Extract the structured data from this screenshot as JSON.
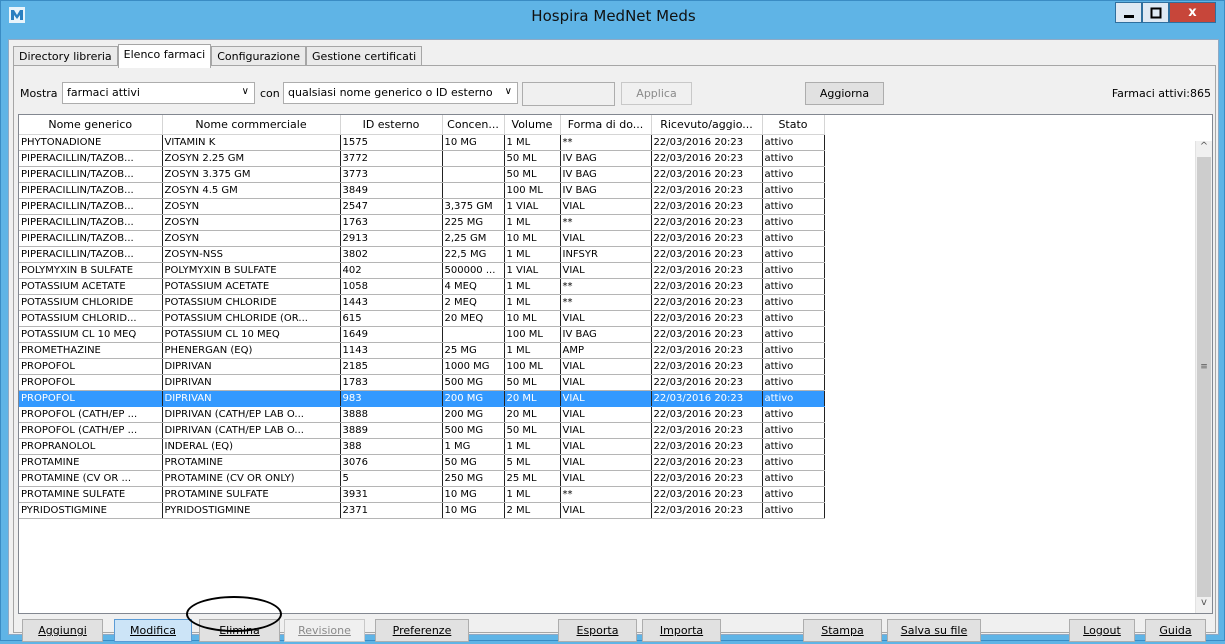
{
  "window": {
    "title": "Hospira MedNet Meds",
    "minimize_glyph": "‒",
    "maximize_glyph": "□",
    "close_glyph": "x"
  },
  "tabs": [
    "Directory libreria",
    "Elenco farmaci",
    "Configurazione",
    "Gestione certificati"
  ],
  "filter": {
    "show_label": "Mostra",
    "show_value": "farmaci attivi",
    "with_label": "con",
    "with_value": "qualsiasi nome generico o ID esterno",
    "apply_label": "Applica",
    "refresh_label": "Aggiorna",
    "count_text": "Farmaci attivi:865"
  },
  "table": {
    "columns": [
      "Nome generico",
      "Nome cormmerciale",
      "ID esterno",
      "Concen...",
      "Volume",
      "Forma di do...",
      "Ricevuto/aggio...",
      "Stato"
    ],
    "selected_row_index": 16,
    "rows": [
      [
        "PHYTONADIONE",
        "VITAMIN K",
        "1575",
        "10 MG",
        "1 ML",
        "**",
        "22/03/2016 20:23",
        "attivo"
      ],
      [
        "PIPERACILLIN/TAZOB...",
        "ZOSYN 2.25 GM",
        "3772",
        "",
        "50 ML",
        "IV BAG",
        "22/03/2016 20:23",
        "attivo"
      ],
      [
        "PIPERACILLIN/TAZOB...",
        "ZOSYN 3.375 GM",
        "3773",
        "",
        "50 ML",
        "IV BAG",
        "22/03/2016 20:23",
        "attivo"
      ],
      [
        "PIPERACILLIN/TAZOB...",
        "ZOSYN 4.5 GM",
        "3849",
        "",
        "100 ML",
        "IV BAG",
        "22/03/2016 20:23",
        "attivo"
      ],
      [
        "PIPERACILLIN/TAZOB...",
        "ZOSYN",
        "2547",
        "3,375 GM",
        "1 VIAL",
        "VIAL",
        "22/03/2016 20:23",
        "attivo"
      ],
      [
        "PIPERACILLIN/TAZOB...",
        "ZOSYN",
        "1763",
        "225 MG",
        "1 ML",
        "**",
        "22/03/2016 20:23",
        "attivo"
      ],
      [
        "PIPERACILLIN/TAZOB...",
        "ZOSYN",
        "2913",
        "2,25 GM",
        "10 ML",
        "VIAL",
        "22/03/2016 20:23",
        "attivo"
      ],
      [
        "PIPERACILLIN/TAZOB...",
        "ZOSYN-NSS",
        "3802",
        "22,5 MG",
        "1 ML",
        "INFSYR",
        "22/03/2016 20:23",
        "attivo"
      ],
      [
        "POLYMYXIN B SULFATE",
        "POLYMYXIN B SULFATE",
        "402",
        "500000 ...",
        "1 VIAL",
        "VIAL",
        "22/03/2016 20:23",
        "attivo"
      ],
      [
        "POTASSIUM ACETATE",
        "POTASSIUM ACETATE",
        "1058",
        "4 MEQ",
        "1 ML",
        "**",
        "22/03/2016 20:23",
        "attivo"
      ],
      [
        "POTASSIUM CHLORIDE",
        "POTASSIUM CHLORIDE",
        "1443",
        "2 MEQ",
        "1 ML",
        "**",
        "22/03/2016 20:23",
        "attivo"
      ],
      [
        "POTASSIUM CHLORID...",
        "POTASSIUM CHLORIDE (OR...",
        "615",
        "20 MEQ",
        "10 ML",
        "VIAL",
        "22/03/2016 20:23",
        "attivo"
      ],
      [
        "POTASSIUM CL 10 MEQ",
        "POTASSIUM CL 10 MEQ",
        "1649",
        "",
        "100 ML",
        "IV BAG",
        "22/03/2016 20:23",
        "attivo"
      ],
      [
        "PROMETHAZINE",
        "PHENERGAN (EQ)",
        "1143",
        "25 MG",
        "1 ML",
        "AMP",
        "22/03/2016 20:23",
        "attivo"
      ],
      [
        "PROPOFOL",
        "DIPRIVAN",
        "2185",
        "1000 MG",
        "100 ML",
        "VIAL",
        "22/03/2016 20:23",
        "attivo"
      ],
      [
        "PROPOFOL",
        "DIPRIVAN",
        "1783",
        "500 MG",
        "50 ML",
        "VIAL",
        "22/03/2016 20:23",
        "attivo"
      ],
      [
        "PROPOFOL",
        "DIPRIVAN",
        "983",
        "200 MG",
        "20 ML",
        "VIAL",
        "22/03/2016 20:23",
        "attivo"
      ],
      [
        "PROPOFOL (CATH/EP ...",
        "DIPRIVAN (CATH/EP LAB O...",
        "3888",
        "200 MG",
        "20 ML",
        "VIAL",
        "22/03/2016 20:23",
        "attivo"
      ],
      [
        "PROPOFOL (CATH/EP ...",
        "DIPRIVAN (CATH/EP LAB O...",
        "3889",
        "500 MG",
        "50 ML",
        "VIAL",
        "22/03/2016 20:23",
        "attivo"
      ],
      [
        "PROPRANOLOL",
        "INDERAL (EQ)",
        "388",
        "1 MG",
        "1 ML",
        "VIAL",
        "22/03/2016 20:23",
        "attivo"
      ],
      [
        "PROTAMINE",
        "PROTAMINE",
        "3076",
        "50 MG",
        "5 ML",
        "VIAL",
        "22/03/2016 20:23",
        "attivo"
      ],
      [
        "PROTAMINE (CV OR ...",
        "PROTAMINE (CV OR ONLY)",
        "5",
        "250 MG",
        "25 ML",
        "VIAL",
        "22/03/2016 20:23",
        "attivo"
      ],
      [
        "PROTAMINE SULFATE",
        "PROTAMINE SULFATE",
        "3931",
        "10 MG",
        "1 ML",
        "**",
        "22/03/2016 20:23",
        "attivo"
      ],
      [
        "PYRIDOSTIGMINE",
        "PYRIDOSTIGMINE",
        "2371",
        "10 MG",
        "2 ML",
        "VIAL",
        "22/03/2016 20:23",
        "attivo"
      ]
    ]
  },
  "scrollbar": {
    "up_glyph": "^",
    "down_glyph": "v",
    "grip_glyph": "≡"
  },
  "buttons": {
    "add": "Aggiungi",
    "edit": "Modifica",
    "delete": "Elimina",
    "review": "Revisione",
    "prefs": "Preferenze",
    "export": "Esporta",
    "import": "Importa",
    "print": "Stampa",
    "save_file": "Salva su file",
    "logout": "Logout",
    "help": "Guida"
  },
  "colors": {
    "selection": "#3399ff",
    "window_frame": "#5fb4e6",
    "close_button": "#c7463a"
  }
}
